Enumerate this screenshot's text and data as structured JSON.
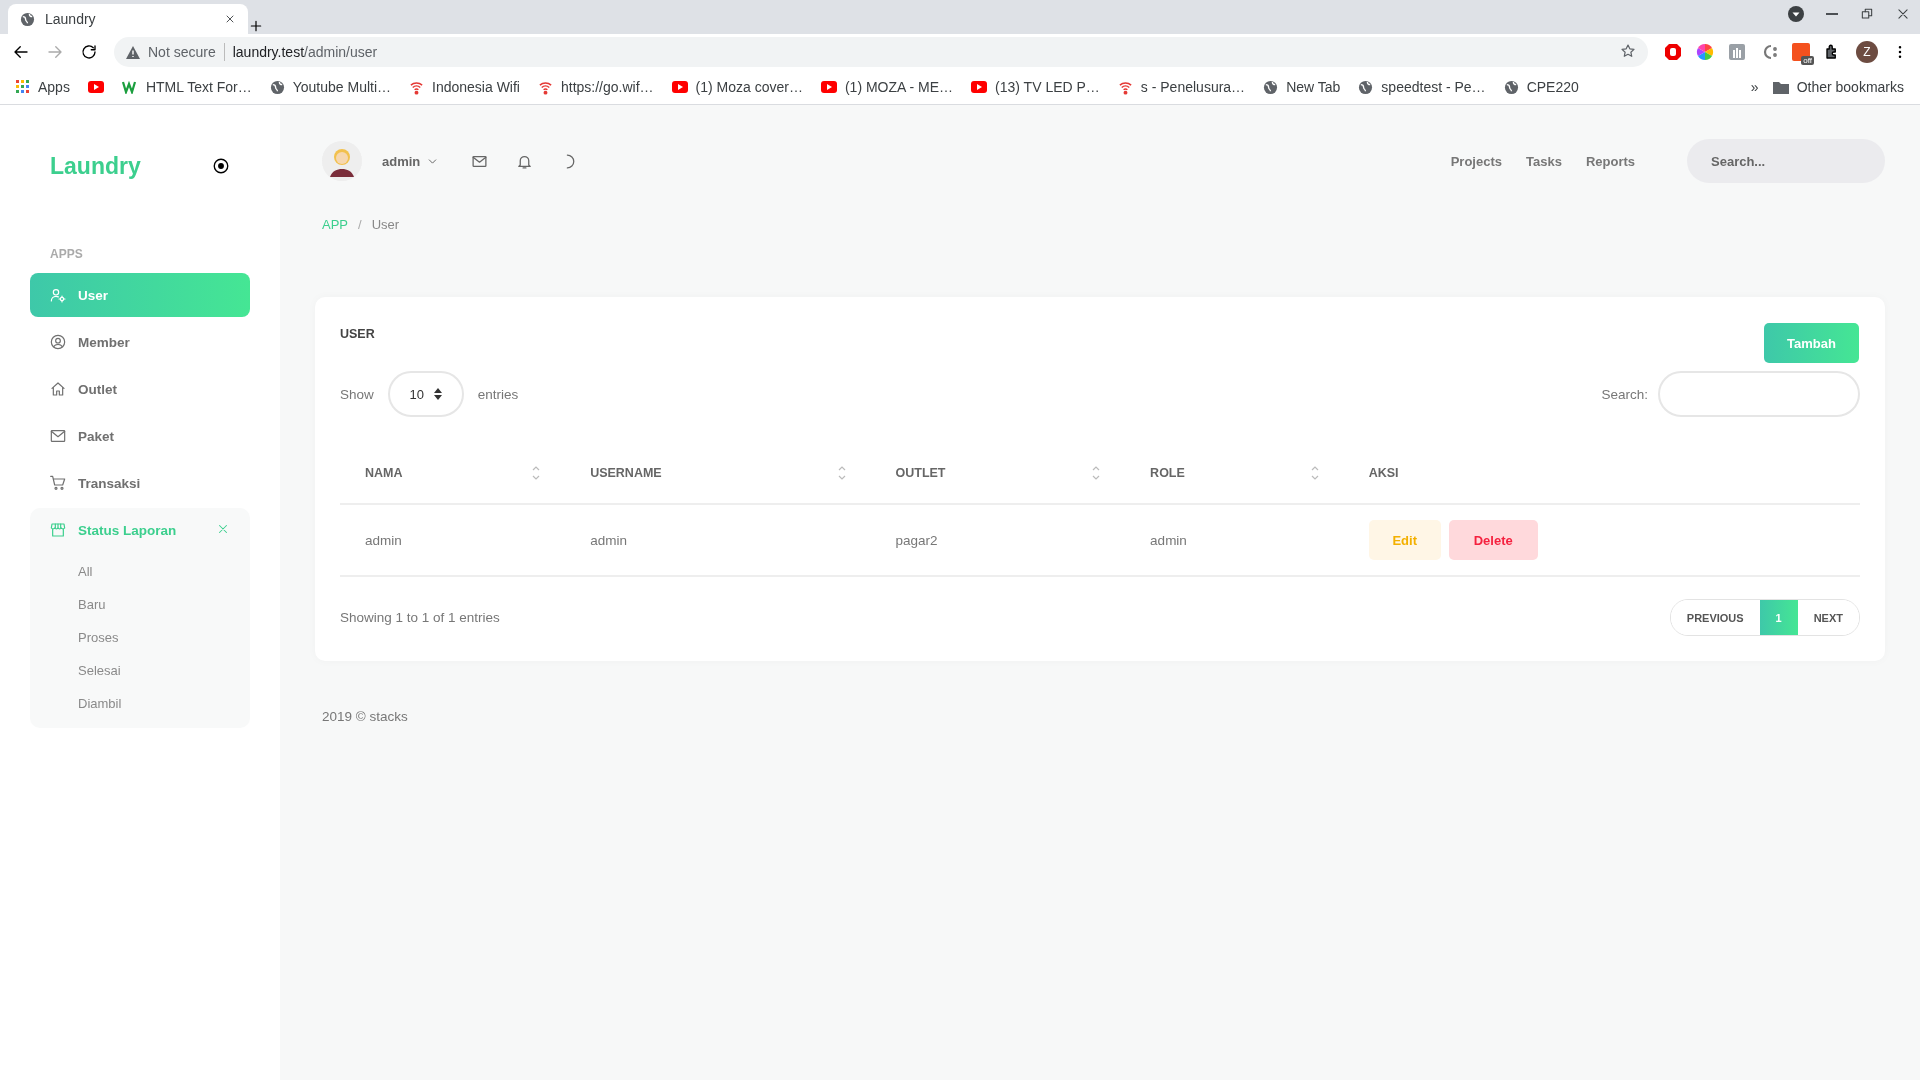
{
  "browser": {
    "tab_title": "Laundry",
    "security": "Not secure",
    "url_host": "laundry.test",
    "url_path": "/admin/user",
    "extension_badge": "off",
    "profile_initial": "Z",
    "bookmarks": [
      {
        "label": "Apps",
        "kind": "apps"
      },
      {
        "kind": "youtube"
      },
      {
        "label": "HTML Text For…",
        "kind": "w3"
      },
      {
        "label": "Youtube Multi…",
        "kind": "globe"
      },
      {
        "label": "Indonesia Wifi",
        "kind": "wifi"
      },
      {
        "label": "https://go.wif…",
        "kind": "wifi"
      },
      {
        "label": "(1) Moza cover…",
        "kind": "youtube"
      },
      {
        "label": "(1) MOZA - ME…",
        "kind": "youtube"
      },
      {
        "label": "(13) TV LED P…",
        "kind": "youtube"
      },
      {
        "label": "s - Penelusura…",
        "kind": "wifi"
      },
      {
        "label": "New Tab",
        "kind": "globe"
      },
      {
        "label": "speedtest - Pe…",
        "kind": "globe"
      },
      {
        "label": "CPE220",
        "kind": "globe"
      }
    ],
    "more": "»",
    "other_bookmarks": "Other bookmarks"
  },
  "sidebar": {
    "logo": "Laundry",
    "section": "APPS",
    "items": [
      {
        "label": "User",
        "kind": "user-gear",
        "selected": true
      },
      {
        "label": "Member",
        "kind": "user-circle",
        "selected": false
      },
      {
        "label": "Outlet",
        "kind": "home",
        "selected": false
      },
      {
        "label": "Paket",
        "kind": "mail",
        "selected": false
      },
      {
        "label": "Transaksi",
        "kind": "cart",
        "selected": false
      },
      {
        "label": "Status Laporan",
        "kind": "store",
        "selected": false,
        "expanded": true,
        "children": [
          {
            "label": "All"
          },
          {
            "label": "Baru"
          },
          {
            "label": "Proses"
          },
          {
            "label": "Selesai"
          },
          {
            "label": "Diambil"
          }
        ]
      }
    ]
  },
  "header": {
    "user": "admin",
    "nav": [
      "Projects",
      "Tasks",
      "Reports"
    ],
    "search": {
      "placeholder": "Search..."
    }
  },
  "breadcrumb_separator": "/",
  "breadcrumb": [
    {
      "label": "APP",
      "selected": false
    },
    {
      "label": "User",
      "selected": true
    }
  ],
  "card": {
    "title": "USER",
    "add_button": "Tambah",
    "show_label": "Show",
    "page_size": "10",
    "entries_label": "entries",
    "search_label": "Search:",
    "table": {
      "columns": [
        {
          "label": "NAMA",
          "sortable": true
        },
        {
          "label": "USERNAME",
          "sortable": true
        },
        {
          "label": "OUTLET",
          "sortable": true
        },
        {
          "label": "ROLE",
          "sortable": true
        },
        {
          "label": "AKSI",
          "sortable": false
        }
      ],
      "rows": [
        {
          "cells": [
            "admin",
            "admin",
            "pagar2",
            "admin"
          ],
          "actions": [
            {
              "label": "Edit",
              "kind": "edit"
            },
            {
              "label": "Delete",
              "kind": "delete"
            }
          ]
        }
      ]
    },
    "info": "Showing 1 to 1 of 1 entries",
    "pagination": [
      {
        "label": "PREVIOUS",
        "kind": "nav",
        "selected": false
      },
      {
        "label": "1",
        "kind": "page",
        "selected": true
      },
      {
        "label": "NEXT",
        "kind": "nav",
        "selected": false
      }
    ]
  },
  "footer": "2019 © stacks"
}
